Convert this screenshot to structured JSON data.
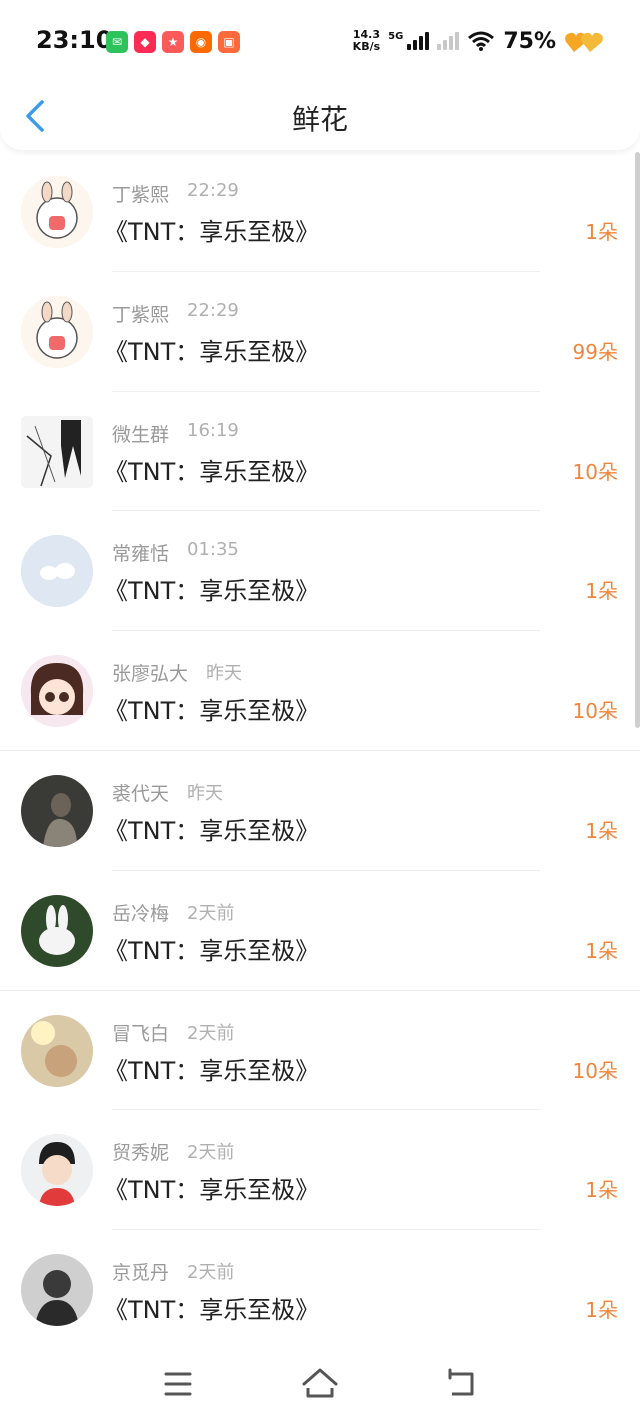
{
  "status_bar": {
    "time": "23:10",
    "net_speed_value": "14.3",
    "net_speed_unit": "KB/s",
    "network_type": "5G",
    "battery": "75%",
    "notification_icons": [
      "wechat-icon",
      "xiaohongshu-icon",
      "shop-app-icon",
      "taobao-icon",
      "video-app-icon"
    ]
  },
  "header": {
    "title": "鲜花"
  },
  "colors": {
    "accent_back": "#3b9be8",
    "count_orange": "#f0863d",
    "meta_gray": "#9a9a9a"
  },
  "list": [
    {
      "name": "丁紫熙",
      "time": "22:29",
      "book": "《TNT：享乐至极》",
      "count": "1朵"
    },
    {
      "name": "丁紫熙",
      "time": "22:29",
      "book": "《TNT：享乐至极》",
      "count": "99朵"
    },
    {
      "name": "微生群",
      "time": "16:19",
      "book": "《TNT：享乐至极》",
      "count": "10朵"
    },
    {
      "name": "常雍恬",
      "time": "01:35",
      "book": "《TNT：享乐至极》",
      "count": "1朵"
    },
    {
      "name": "张廖弘大",
      "time": "昨天",
      "book": "《TNT：享乐至极》",
      "count": "10朵"
    },
    {
      "name": "裘代天",
      "time": "昨天",
      "book": "《TNT：享乐至极》",
      "count": "1朵"
    },
    {
      "name": "岳冷梅",
      "time": "2天前",
      "book": "《TNT：享乐至极》",
      "count": "1朵"
    },
    {
      "name": "冒飞白",
      "time": "2天前",
      "book": "《TNT：享乐至极》",
      "count": "10朵"
    },
    {
      "name": "贸秀妮",
      "time": "2天前",
      "book": "《TNT：享乐至极》",
      "count": "1朵"
    },
    {
      "name": "京觅丹",
      "time": "2天前",
      "book": "《TNT：享乐至极》",
      "count": "1朵"
    }
  ],
  "nav": {
    "menu_icon": "menu-icon",
    "home_icon": "home-icon",
    "back_icon": "back-icon"
  }
}
